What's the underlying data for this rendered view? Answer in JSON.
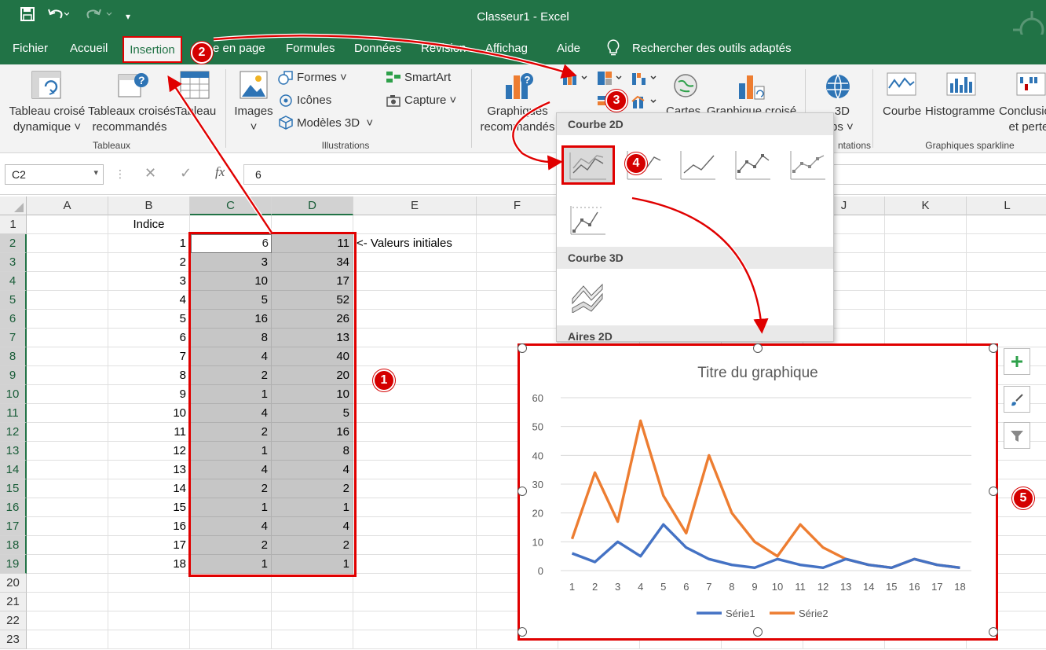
{
  "window": {
    "title": "Classeur1  -  Excel"
  },
  "tabs": [
    {
      "label": "Fichier"
    },
    {
      "label": "Accueil"
    },
    {
      "label": "Insertion"
    },
    {
      "label": "e en page"
    },
    {
      "label": "Formules"
    },
    {
      "label": "Données"
    },
    {
      "label": "Révision"
    },
    {
      "label": "Affichag"
    },
    {
      "label": "Aide"
    },
    {
      "label": "Rechercher des outils adaptés"
    }
  ],
  "ribbon": {
    "tableaux": {
      "pivot_l1": "Tableau croisé",
      "pivot_l2": "dynamique",
      "rec_l1": "Tableaux croisés",
      "rec_l2": "recommandés",
      "table": "Tableau",
      "group": "Tableaux"
    },
    "illustrations": {
      "images": "Images",
      "formes": "Formes",
      "icones": "Icônes",
      "modeles": "Modèles 3D",
      "smartart": "SmartArt",
      "capture": "Capture",
      "group": "Illustrations"
    },
    "charts": {
      "rec_l1": "Graphiques",
      "rec_l2": "recommandés",
      "cartes": "Cartes",
      "pivot_chart": "Graphique croisé",
      "maps_l1": "3D",
      "maps_l2": "ps",
      "group_partial": "ntations"
    },
    "sparklines": {
      "courbe": "Courbe",
      "histogramme": "Histogramme",
      "winloss_l1": "Conclusio",
      "winloss_l2": "et perte",
      "group": "Graphiques sparkline"
    }
  },
  "formula_bar": {
    "name_box": "C2",
    "fx_label": "fx",
    "value": "6"
  },
  "columns": [
    "A",
    "B",
    "C",
    "D",
    "E",
    "F",
    "G",
    "H",
    "I",
    "J",
    "K",
    "L"
  ],
  "sheet": {
    "header_b": "Indice",
    "note_e2": "<- Valeurs initiales",
    "rows": [
      {
        "row": "2",
        "b": "1",
        "c": "6",
        "d": "11"
      },
      {
        "row": "3",
        "b": "2",
        "c": "3",
        "d": "34"
      },
      {
        "row": "4",
        "b": "3",
        "c": "10",
        "d": "17"
      },
      {
        "row": "5",
        "b": "4",
        "c": "5",
        "d": "52"
      },
      {
        "row": "6",
        "b": "5",
        "c": "16",
        "d": "26"
      },
      {
        "row": "7",
        "b": "6",
        "c": "8",
        "d": "13"
      },
      {
        "row": "8",
        "b": "7",
        "c": "4",
        "d": "40"
      },
      {
        "row": "9",
        "b": "8",
        "c": "2",
        "d": "20"
      },
      {
        "row": "10",
        "b": "9",
        "c": "1",
        "d": "10"
      },
      {
        "row": "11",
        "b": "10",
        "c": "4",
        "d": "5"
      },
      {
        "row": "12",
        "b": "11",
        "c": "2",
        "d": "16"
      },
      {
        "row": "13",
        "b": "12",
        "c": "1",
        "d": "8"
      },
      {
        "row": "14",
        "b": "13",
        "c": "4",
        "d": "4"
      },
      {
        "row": "15",
        "b": "14",
        "c": "2",
        "d": "2"
      },
      {
        "row": "16",
        "b": "15",
        "c": "1",
        "d": "1"
      },
      {
        "row": "17",
        "b": "16",
        "c": "4",
        "d": "4"
      },
      {
        "row": "18",
        "b": "17",
        "c": "2",
        "d": "2"
      },
      {
        "row": "19",
        "b": "18",
        "c": "1",
        "d": "1"
      }
    ],
    "extra_rows": [
      "1",
      "20",
      "21",
      "22",
      "23"
    ]
  },
  "dropdown": {
    "sections": [
      "Courbe 2D",
      "Courbe 3D",
      "Aires 2D"
    ]
  },
  "badges": [
    "1",
    "2",
    "3",
    "4",
    "5"
  ],
  "colors": {
    "excel_green": "#217346",
    "serie1": "#4472c4",
    "serie2": "#ed7d31",
    "highlight": "#e00000"
  },
  "chart_data": {
    "type": "line",
    "title": "Titre du graphique",
    "categories": [
      "1",
      "2",
      "3",
      "4",
      "5",
      "6",
      "7",
      "8",
      "9",
      "10",
      "11",
      "12",
      "13",
      "14",
      "15",
      "16",
      "17",
      "18"
    ],
    "series": [
      {
        "name": "Série1",
        "values": [
          6,
          3,
          10,
          5,
          16,
          8,
          4,
          2,
          1,
          4,
          2,
          1,
          4,
          2,
          1,
          4,
          2,
          1
        ],
        "color": "#4472c4"
      },
      {
        "name": "Série2",
        "values": [
          11,
          34,
          17,
          52,
          26,
          13,
          40,
          20,
          10,
          5,
          16,
          8,
          4,
          2,
          1,
          4,
          2,
          1
        ],
        "color": "#ed7d31"
      }
    ],
    "ylim": [
      0,
      60
    ],
    "yticks": [
      "0",
      "10",
      "20",
      "30",
      "40",
      "50",
      "60"
    ],
    "grid": true,
    "legend": "bottom"
  }
}
